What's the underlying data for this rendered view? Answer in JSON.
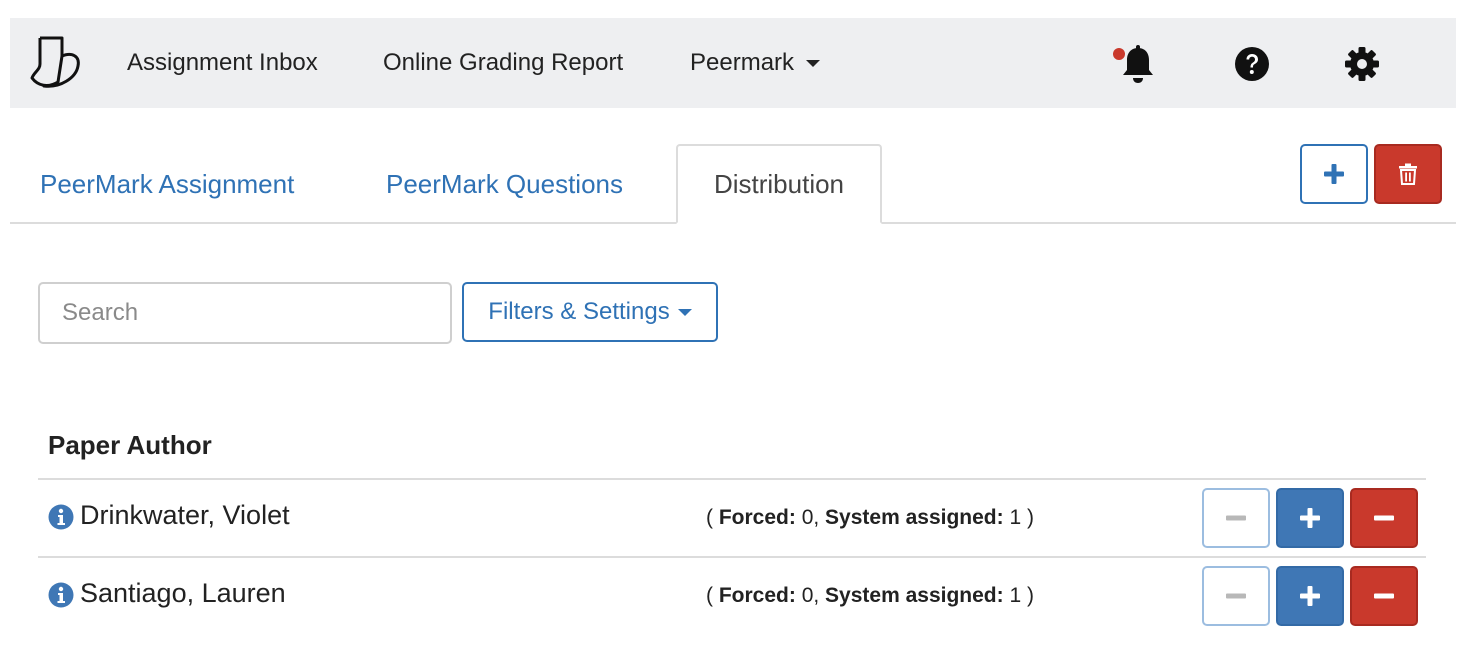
{
  "nav": {
    "items": [
      {
        "label": "Assignment Inbox"
      },
      {
        "label": "Online Grading Report"
      },
      {
        "label": "Peermark"
      }
    ],
    "icons": [
      "notification-bell-icon",
      "help-icon",
      "gear-icon"
    ]
  },
  "tabs": [
    {
      "label": "PeerMark Assignment",
      "active": false
    },
    {
      "label": "PeerMark Questions",
      "active": false
    },
    {
      "label": "Distribution",
      "active": true
    }
  ],
  "toolbar": {
    "add_icon": "plus-icon",
    "delete_icon": "trash-icon"
  },
  "search": {
    "placeholder": "Search",
    "value": ""
  },
  "filters": {
    "label": "Filters & Settings"
  },
  "table": {
    "header": "Paper Author",
    "forced_label": "Forced:",
    "system_label": "System assigned:",
    "rows": [
      {
        "name": "Drinkwater, Violet",
        "forced": "0",
        "system_assigned": "1"
      },
      {
        "name": "Santiago, Lauren",
        "forced": "0",
        "system_assigned": "1"
      }
    ]
  },
  "colors": {
    "accent": "#2f72b5",
    "danger": "#c9392c",
    "navbar_bg": "#eeeff1",
    "notification_dot": "#c9392c"
  }
}
